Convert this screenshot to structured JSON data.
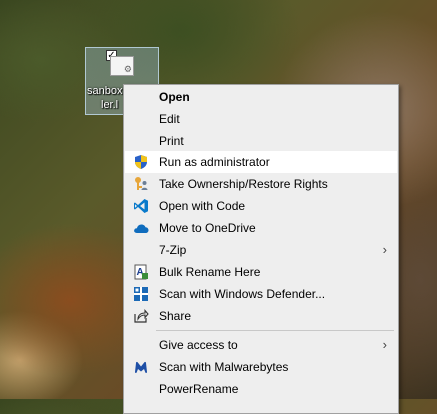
{
  "desktop_icon": {
    "label_line1": "sanbox",
    "label_line2": "ler.l",
    "checked_mark": "✓"
  },
  "context_menu": {
    "items": [
      {
        "label": "Open",
        "icon": "none",
        "bold": true
      },
      {
        "label": "Edit",
        "icon": "none"
      },
      {
        "label": "Print",
        "icon": "none"
      },
      {
        "label": "Run as administrator",
        "icon": "uac-shield-icon",
        "hovered": true
      },
      {
        "label": "Take Ownership/Restore Rights",
        "icon": "key-user-icon"
      },
      {
        "label": "Open with Code",
        "icon": "vscode-icon"
      },
      {
        "label": "Move to OneDrive",
        "icon": "onedrive-cloud-icon"
      },
      {
        "label": "7-Zip",
        "icon": "none",
        "submenu": true
      },
      {
        "label": "Bulk Rename Here",
        "icon": "bulk-rename-icon"
      },
      {
        "label": "Scan with Windows Defender...",
        "icon": "defender-icon"
      },
      {
        "label": "Share",
        "icon": "share-icon"
      },
      {
        "label": "Give access to",
        "icon": "none",
        "submenu": true
      },
      {
        "label": "Scan with Malwarebytes",
        "icon": "malwarebytes-icon"
      },
      {
        "label": "PowerRename",
        "icon": "none"
      }
    ],
    "submenu_arrow": "›"
  },
  "colors": {
    "menu_bg": "#eeeeee",
    "hover_bg": "#ffffff",
    "vscode_blue": "#0a7acb",
    "onedrive_blue": "#0f6cbd",
    "defender_blue": "#1b69b6",
    "malwarebytes_blue": "#1e4fa6"
  }
}
